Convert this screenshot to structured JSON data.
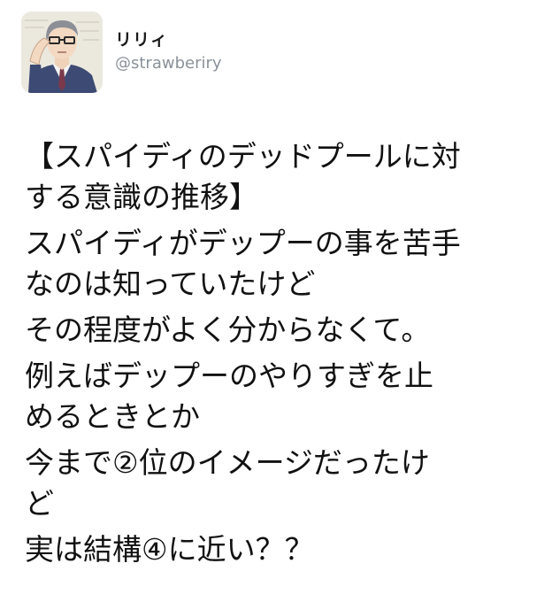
{
  "user": {
    "display_name": "リリィ",
    "handle": "@strawberiry",
    "avatar_icon": "avatar-glasses-man-illustration"
  },
  "tweet": {
    "lines": [
      "【スパイディのデッドプールに対",
      "する意識の推移】",
      "スパイディがデップーの事を苦手",
      "なのは知っていたけど",
      "その程度がよく分からなくて。",
      "例えばデップーのやりすぎを止",
      "めるときとか",
      "今まで②位のイメージだったけ",
      "ど",
      "実は結構④に近い？？"
    ]
  },
  "colors": {
    "text": "#111111",
    "handle": "#8a9199",
    "background": "#ffffff"
  }
}
